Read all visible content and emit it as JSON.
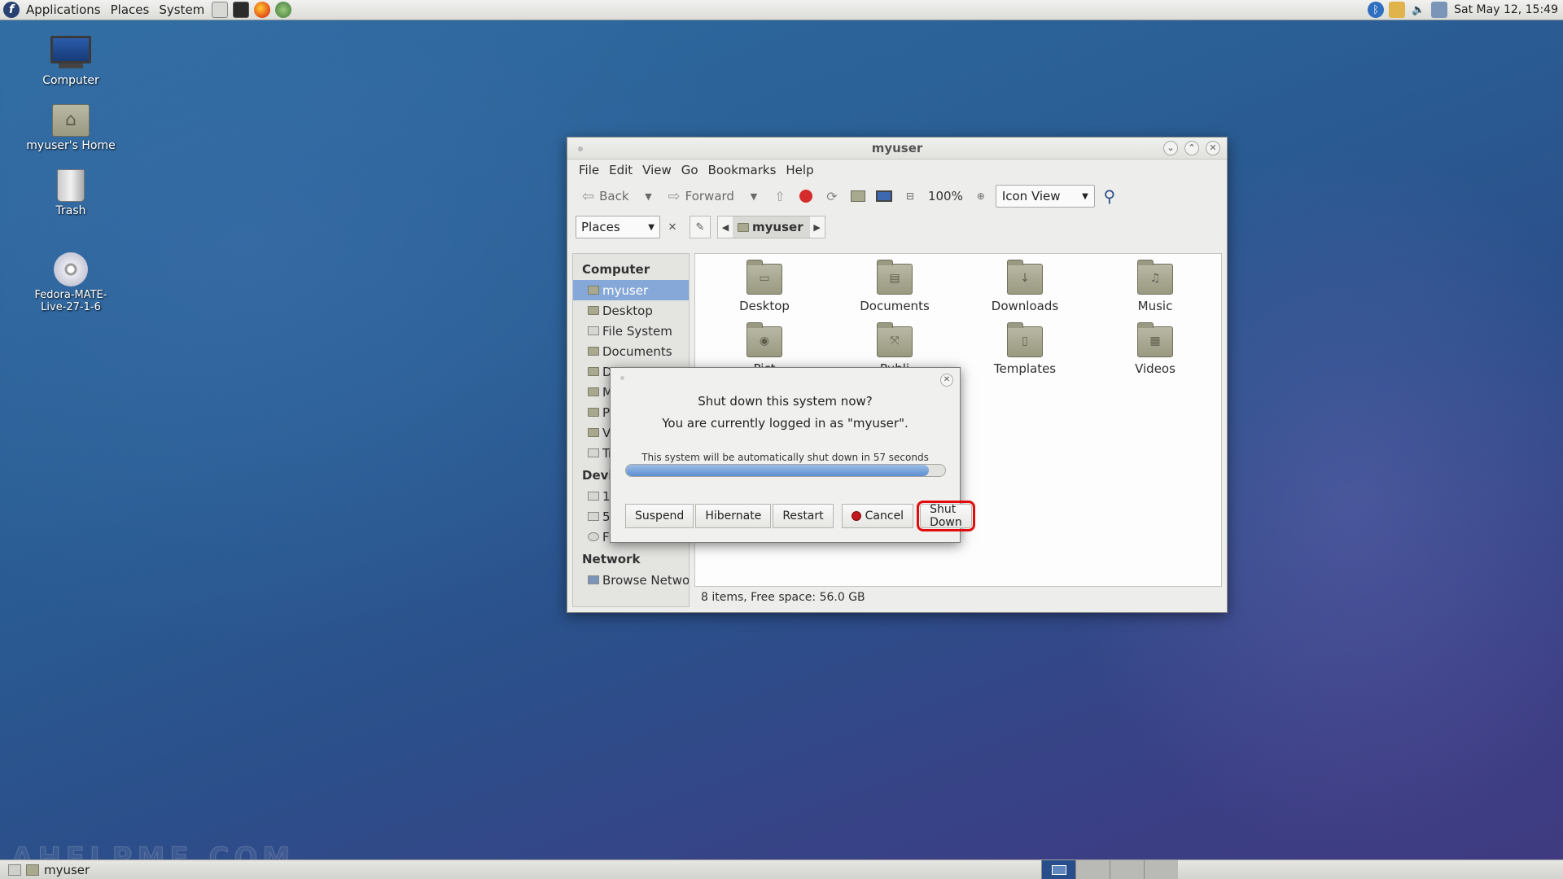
{
  "top_panel": {
    "menus": [
      "Applications",
      "Places",
      "System"
    ],
    "clock": "Sat May 12, 15:49"
  },
  "desktop_icons": [
    {
      "label": "Computer"
    },
    {
      "label": "myuser's Home"
    },
    {
      "label": "Trash"
    },
    {
      "label": "Fedora-MATE-Live-27-1-6"
    }
  ],
  "file_manager": {
    "title": "myuser",
    "menu": [
      "File",
      "Edit",
      "View",
      "Go",
      "Bookmarks",
      "Help"
    ],
    "toolbar": {
      "back": "Back",
      "forward": "Forward",
      "zoom": "100%",
      "view_mode": "Icon View"
    },
    "location": {
      "places_label": "Places",
      "current_crumb": "myuser"
    },
    "sidebar": {
      "computer_heading": "Computer",
      "items": [
        "myuser",
        "Desktop",
        "File System",
        "Documents",
        "D",
        "M",
        "Pi",
        "V",
        "Tr"
      ],
      "devices_heading": "Devi",
      "device_items": [
        "1",
        "5",
        "F"
      ],
      "network_heading": "Network",
      "network_items": [
        "Browse Network"
      ]
    },
    "files": [
      "Desktop",
      "Documents",
      "Downloads",
      "Music",
      "Pict",
      "Publi",
      "Templates",
      "Videos"
    ],
    "status": "8 items, Free space: 56.0 GB"
  },
  "dialog": {
    "line1": "Shut down this system now?",
    "line2": "You are currently logged in as \"myuser\".",
    "note": "This system will be automatically shut down in 57 seconds",
    "progress_percent": 95,
    "buttons": {
      "suspend": "Suspend",
      "hibernate": "Hibernate",
      "restart": "Restart",
      "cancel": "Cancel",
      "shutdown": "Shut Down"
    }
  },
  "bottom_panel": {
    "task": "myuser",
    "watermark": "AHELPME.COM"
  }
}
